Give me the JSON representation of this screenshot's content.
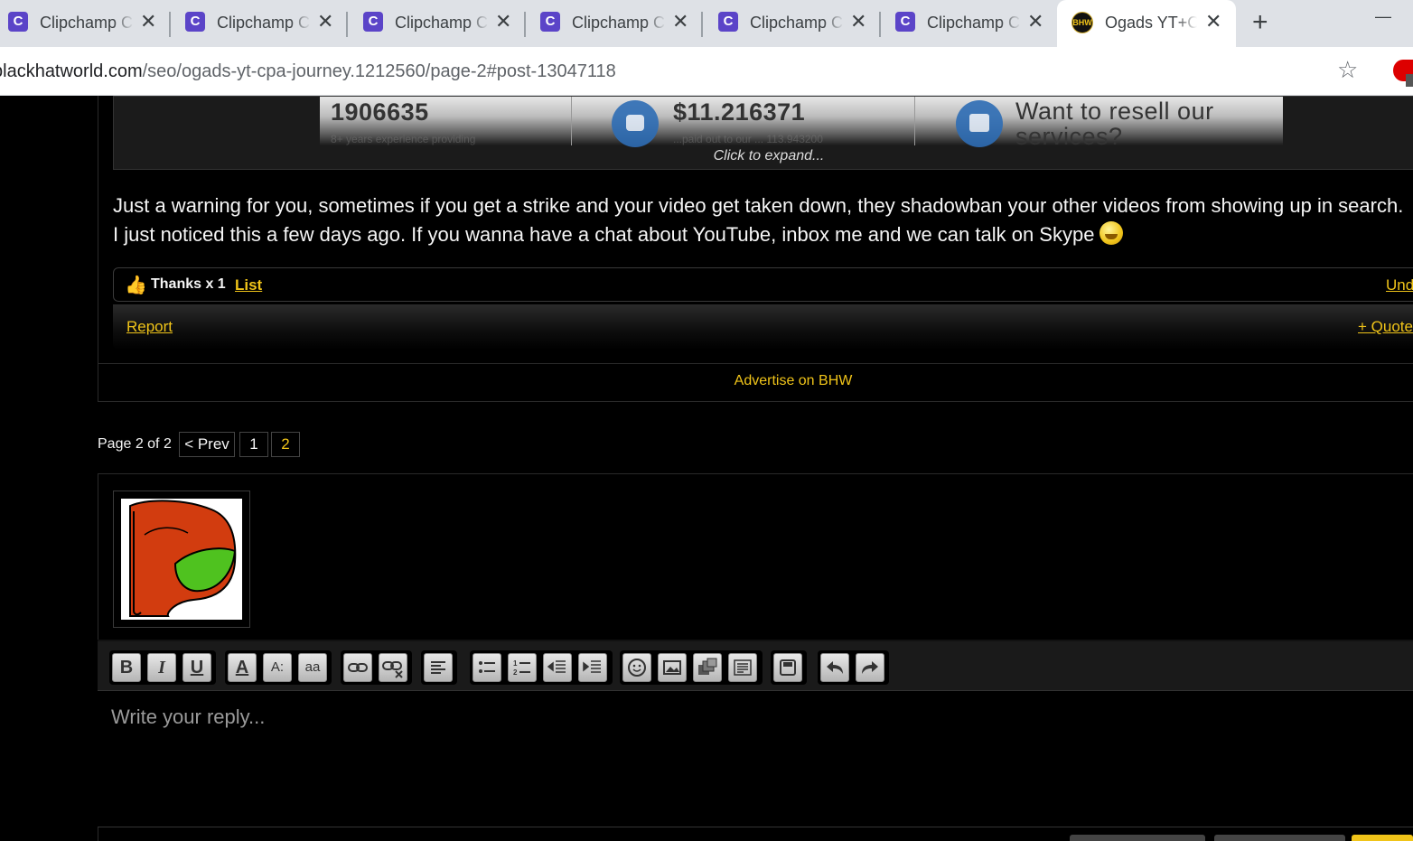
{
  "browser": {
    "tabs": [
      {
        "title": "Clipchamp Create",
        "favicon": "C"
      },
      {
        "title": "Clipchamp Create",
        "favicon": "C"
      },
      {
        "title": "Clipchamp Create",
        "favicon": "C"
      },
      {
        "title": "Clipchamp Create",
        "favicon": "C"
      },
      {
        "title": "Clipchamp Create",
        "favicon": "C"
      },
      {
        "title": "Clipchamp Create",
        "favicon": "C"
      }
    ],
    "active_tab": {
      "title": "Ogads YT+CPA Journey",
      "favicon": "BHW"
    },
    "new_tab_icon": "+",
    "close_icon": "✕",
    "minimize_icon": "—",
    "url_host": "blackhatworld.com",
    "url_path": "/seo/ogads-yt-cpa-journey.1212560/page-2#post-13047118",
    "bookmark_icon": "☆"
  },
  "quote": {
    "stat1_value": "1906635",
    "stat1_sub": "8+ years experience providing",
    "stat2_value": "$11.216371",
    "stat2_sub": "...paid out to our ... 113.943200",
    "stat3_value": "Want to resell our services?",
    "expand_label": "Click to expand..."
  },
  "post": {
    "text": "Just a warning for you, sometimes if you get a strike and your video get taken down, they shadowban your other videos from showing up in search. I just noticed this a few days ago. If you wanna have a chat about YouTube, inbox me and we can talk on Skype",
    "thanks_label": "Thanks x 1",
    "list_link": "List",
    "undo_link": "Undo",
    "report_link": "Report",
    "quote_link": "+ Quote"
  },
  "advertise": "Advertise on BHW",
  "pagination": {
    "label": "Page 2 of 2",
    "prev": "< Prev",
    "pages": [
      "1",
      "2"
    ],
    "current": "2"
  },
  "reply": {
    "placeholder": "Write your reply...",
    "toolbar": {
      "bold": "B",
      "italic": "I",
      "underline": "U",
      "font_color": "A",
      "font_size": "A:",
      "font_family": "aa"
    }
  },
  "colors": {
    "accent": "#f0c419",
    "background": "#000000",
    "text": "#f5f5f5",
    "tab_favicon": "#5b44c8"
  }
}
